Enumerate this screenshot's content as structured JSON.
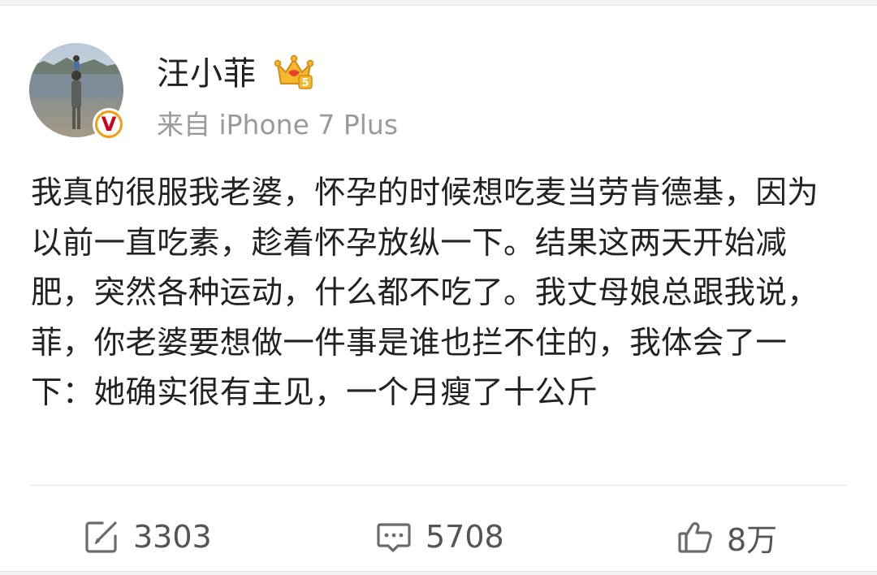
{
  "post": {
    "author": {
      "name": "汪小菲",
      "avatar": "avatar-photo",
      "verified_icon": "verified-v-icon",
      "vip_icon": "crown-icon"
    },
    "source": "来自 iPhone 7 Plus",
    "text": "我真的很服我老婆，怀孕的时候想吃麦当劳肯德基，因为以前一直吃素，趁着怀孕放纵一下。结果这两天开始减肥，突然各种运动，什么都不吃了。我丈母娘总跟我说，菲，你老婆要想做一件事是谁也拦不住的，我体会了一下：她确实很有主见，一个月瘦了十公斤"
  },
  "actions": {
    "repost": {
      "icon": "repost-icon",
      "count": "3303"
    },
    "comment": {
      "icon": "comment-icon",
      "count": "5708"
    },
    "like": {
      "icon": "thumbs-up-icon",
      "count": "8万"
    }
  },
  "colors": {
    "background": "#f2f2f2",
    "card": "#ffffff",
    "text": "#222222",
    "meta": "#9a9a9a",
    "action": "#555555",
    "vip_gold": "#f5a623",
    "verified_orange": "#f39c12",
    "verified_red": "#d0021b"
  }
}
